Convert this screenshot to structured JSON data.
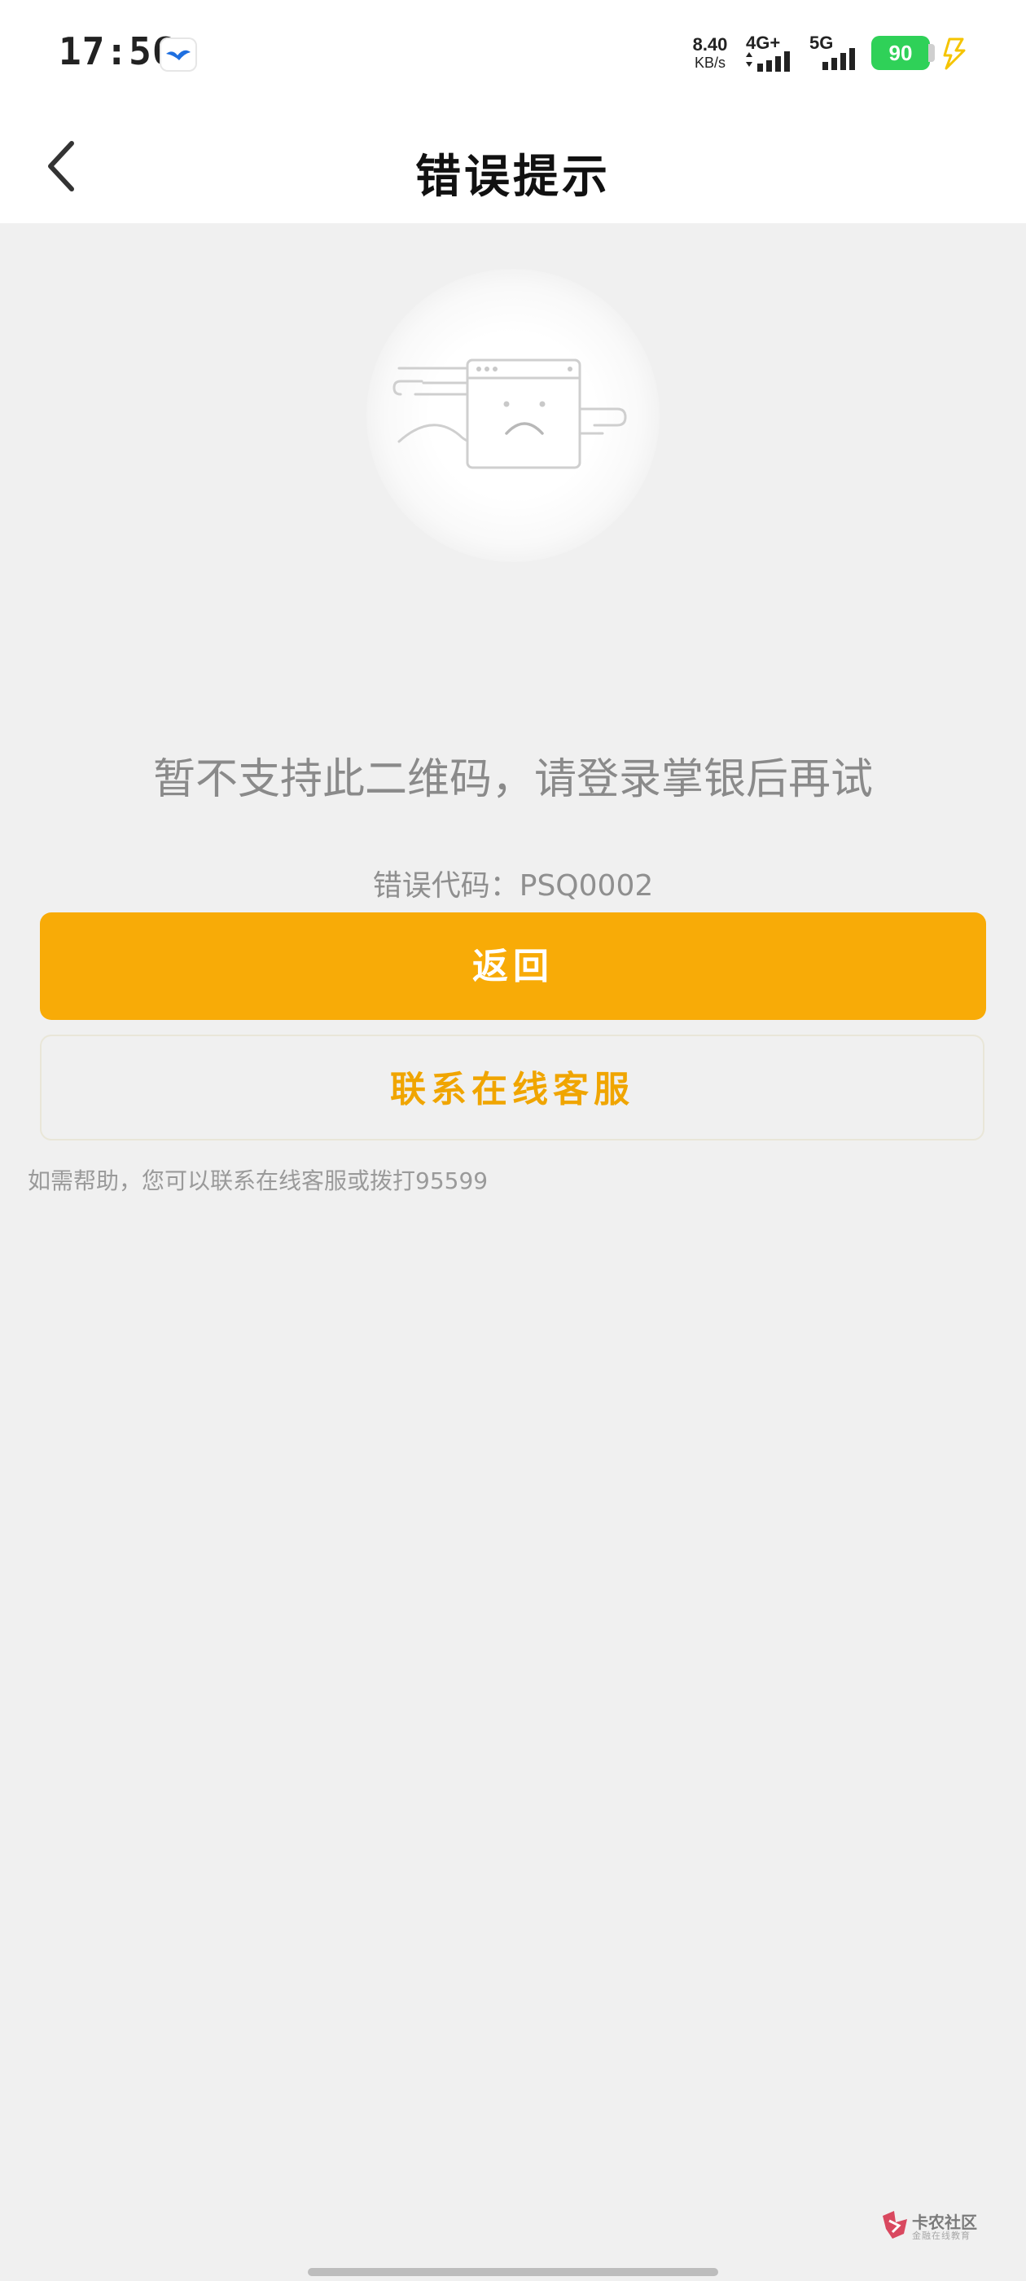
{
  "status_bar": {
    "time": "17:56",
    "speed_value": "8.40",
    "speed_unit": "KB/s",
    "network_1": "4G+",
    "network_2": "5G",
    "battery": "90"
  },
  "header": {
    "title": "错误提示"
  },
  "error": {
    "message": "暂不支持此二维码，请登录掌银后再试",
    "code_text": "错误代码：PSQ0002"
  },
  "buttons": {
    "back_label": "返回",
    "service_label": "联系在线客服"
  },
  "help_text": "如需帮助，您可以联系在线客服或拨打95599",
  "watermark": {
    "name": "卡农社区",
    "sub": "金融在线教育"
  },
  "colors": {
    "primary": "#f8ab07",
    "background": "#f0f0f0"
  }
}
